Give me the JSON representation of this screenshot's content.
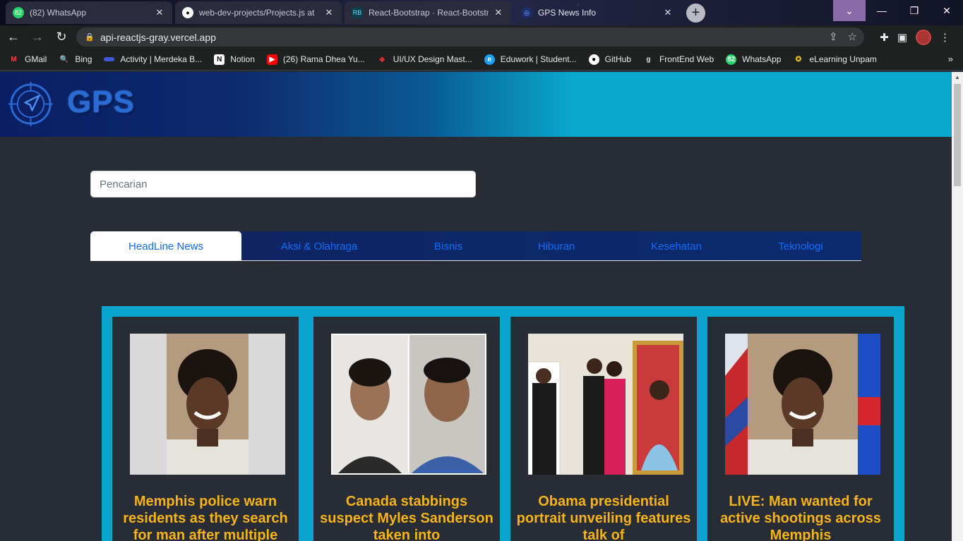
{
  "browser": {
    "tabs": [
      {
        "title": "(82) WhatsApp",
        "favicon": "whatsapp-icon",
        "badge": "82",
        "active": false
      },
      {
        "title": "web-dev-projects/Projects.js at",
        "favicon": "github-icon",
        "active": false
      },
      {
        "title": "React-Bootstrap · React-Bootstrap",
        "favicon": "react-bootstrap-icon",
        "active": false
      },
      {
        "title": "GPS News Info",
        "favicon": "gps-icon",
        "active": true
      }
    ],
    "url": "api-reactjs-gray.vercel.app",
    "bookmarks": [
      {
        "label": "GMail",
        "icon": "gmail-icon",
        "color": "#ea4335"
      },
      {
        "label": "Bing",
        "icon": "bing-icon",
        "color": "#2d7ff9"
      },
      {
        "label": "Activity | Merdeka B...",
        "icon": "kampus-merdeka-icon",
        "color": "#3b5bdb"
      },
      {
        "label": "Notion",
        "icon": "notion-icon",
        "color": "#ffffff"
      },
      {
        "label": "(26) Rama Dhea Yu...",
        "icon": "youtube-icon",
        "color": "#ff0000"
      },
      {
        "label": "UI/UX Design Mast...",
        "icon": "ruby-icon",
        "color": "#d32f2f"
      },
      {
        "label": "Eduwork | Student...",
        "icon": "eduwork-icon",
        "color": "#1da1f2"
      },
      {
        "label": "GitHub",
        "icon": "github-icon",
        "color": "#ffffff"
      },
      {
        "label": "FrontEnd Web",
        "icon": "frontend-icon",
        "color": "#dddddd"
      },
      {
        "label": "WhatsApp",
        "icon": "whatsapp-icon",
        "color": "#25d366"
      },
      {
        "label": "eLearning Unpam",
        "icon": "unpam-icon",
        "color": "#f5c518"
      }
    ]
  },
  "site": {
    "logo_text": "GPS",
    "search_placeholder": "Pencarian",
    "nav_tabs": [
      "HeadLine News",
      "Aksi & Olahraga",
      "Bisnis",
      "Hiburan",
      "Kesehatan",
      "Teknologi"
    ],
    "active_tab": "HeadLine News",
    "accent": "#0aa4cc",
    "headline_color": "#f7b31a",
    "cards": [
      {
        "headline": "Memphis police warn residents as they search for man after multiple"
      },
      {
        "headline": "Canada stabbings suspect Myles Sanderson taken into"
      },
      {
        "headline": "Obama presidential portrait unveiling features talk of"
      },
      {
        "headline": "LIVE: Man wanted for active shootings across Memphis"
      }
    ]
  }
}
